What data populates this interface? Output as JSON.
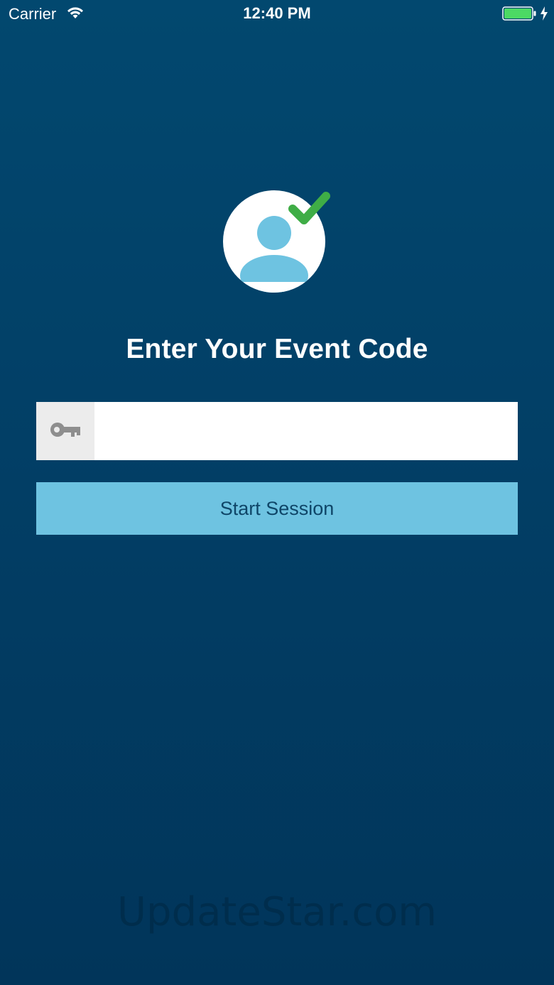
{
  "status_bar": {
    "carrier": "Carrier",
    "time": "12:40 PM",
    "battery_color": "#4cd964"
  },
  "main": {
    "title": "Enter Your Event Code",
    "code_input": {
      "value": "",
      "placeholder": "",
      "icon": "key-icon"
    },
    "start_button_label": "Start Session",
    "logo_icon": "user-check-icon"
  },
  "watermark": "UpdateStar.com",
  "colors": {
    "background_top": "#02486f",
    "background_bottom": "#01355a",
    "button": "#6ec3e1",
    "button_text": "#0f4668",
    "check": "#3fad46",
    "avatar_fill": "#6ec3e1"
  }
}
